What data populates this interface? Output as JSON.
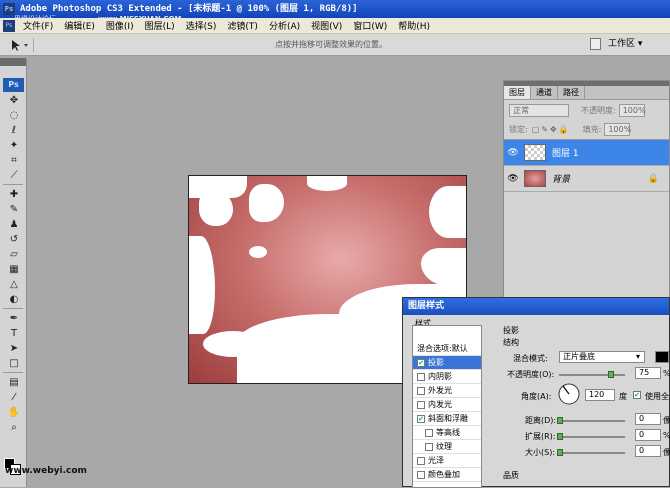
{
  "window": {
    "title": "Adobe Photoshop CS3 Extended - [未标题-1 @ 100% (图层 1, RGB/8)]",
    "watermark_top_a": "思缘设计论坛",
    "watermark_top_b": "www.MISSYUAN.COM"
  },
  "menu": [
    "文件(F)",
    "编辑(E)",
    "图像(I)",
    "图层(L)",
    "选择(S)",
    "滤镜(T)",
    "分析(A)",
    "视图(V)",
    "窗口(W)",
    "帮助(H)"
  ],
  "options_bar": {
    "hint": "点按并拖移可调整效果的位置。",
    "workspace": "工作区 ▾"
  },
  "tools_panel": {
    "logo": "Ps",
    "tools": [
      "move",
      "marquee",
      "lasso",
      "magic-wand",
      "crop",
      "slice",
      "healing",
      "brush",
      "stamp",
      "history-brush",
      "eraser",
      "gradient",
      "blur",
      "dodge",
      "pen",
      "type",
      "path-select",
      "shape",
      "notes",
      "eyedropper",
      "hand",
      "zoom"
    ]
  },
  "layers_panel": {
    "tabs": [
      "图层",
      "通道",
      "路径"
    ],
    "blend_mode": "正常",
    "opacity_label": "不透明度:",
    "opacity": "100%",
    "lock_label": "锁定:",
    "fill_label": "填充:",
    "fill": "100%",
    "layers": [
      {
        "name": "图层 1",
        "selected": true
      },
      {
        "name": "背景",
        "selected": false,
        "locked": true
      }
    ]
  },
  "layer_style_dialog": {
    "title": "图层样式",
    "styles_header": "样式",
    "blend_options": "混合选项:默认",
    "items": [
      {
        "label": "投影",
        "checked": true,
        "selected": true
      },
      {
        "label": "内阴影",
        "checked": false
      },
      {
        "label": "外发光",
        "checked": false
      },
      {
        "label": "内发光",
        "checked": false
      },
      {
        "label": "斜面和浮雕",
        "checked": true
      },
      {
        "label": "等高线",
        "checked": false,
        "indent": true
      },
      {
        "label": "纹理",
        "checked": false,
        "indent": true
      },
      {
        "label": "光泽",
        "checked": false
      },
      {
        "label": "颜色叠加",
        "checked": false
      }
    ],
    "section": "投影",
    "group": "结构",
    "blend_mode_label": "混合模式:",
    "blend_mode_value": "正片叠底",
    "opacity_label": "不透明度(O):",
    "opacity_value": "75",
    "angle_label": "角度(A):",
    "angle_value": "120",
    "angle_unit": "度",
    "global_light_label": "使用全局",
    "distance_label": "距离(D):",
    "distance_value": "0",
    "spread_label": "扩展(R):",
    "spread_value": "0",
    "size_label": "大小(S):",
    "size_value": "0",
    "unit_px": "像",
    "unit_pct": "%",
    "quality_label": "品质"
  },
  "watermark_bottom": "www.webyi.com"
}
